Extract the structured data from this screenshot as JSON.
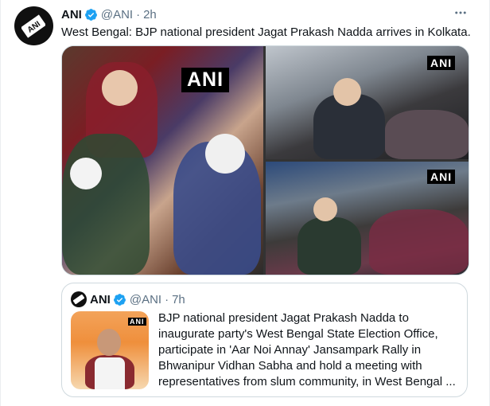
{
  "tweet": {
    "author_name": "ANI",
    "handle": "@ANI",
    "separator": "·",
    "time": "2h",
    "text": "West Bengal: BJP national president Jagat Prakash Nadda arrives in Kolkata.",
    "more_icon": "more-horizontal-icon",
    "media": [
      {
        "watermark": "ANI"
      },
      {
        "watermark": "ANI"
      },
      {
        "watermark": "ANI"
      }
    ]
  },
  "quoted": {
    "author_name": "ANI",
    "handle": "@ANI",
    "separator": "·",
    "time": "7h",
    "thumb_watermark": "ANI",
    "text": "BJP national president Jagat Prakash Nadda to inaugurate party's West Bengal State Election Office, participate in 'Aar Noi Annay' Jansampark Rally in Bhwanipur Vidhan Sabha and hold a meeting with representatives from slum community, in West Bengal ..."
  },
  "colors": {
    "text": "#0f1419",
    "secondary": "#5b7083",
    "verified": "#1da1f2",
    "border": "#cfd9de"
  }
}
